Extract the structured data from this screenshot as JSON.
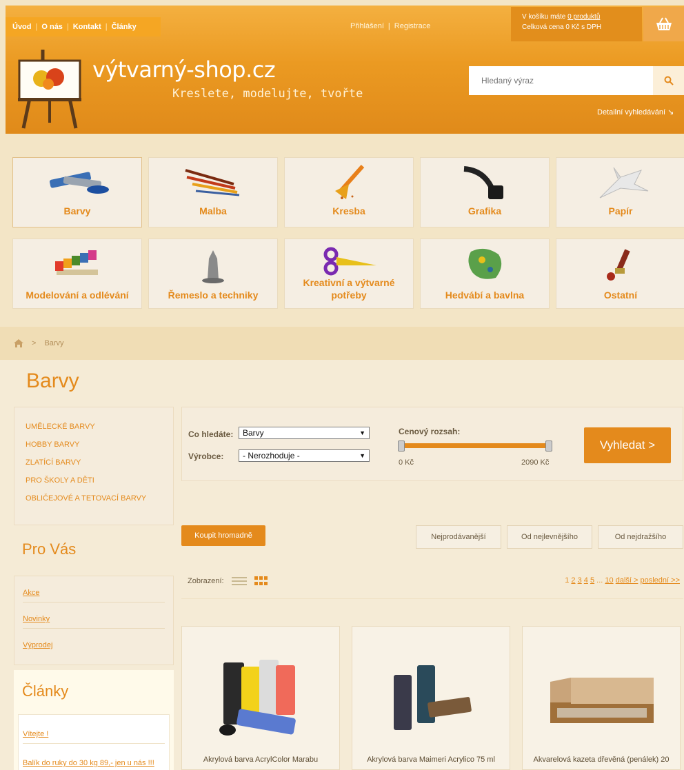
{
  "topnav": {
    "items": [
      "Úvod",
      "O nás",
      "Kontakt",
      "Články"
    ]
  },
  "auth": {
    "login": "Přihlášení",
    "register": "Registrace"
  },
  "cart": {
    "line1_prefix": "V košíku máte ",
    "line1_link": "0 produktů",
    "line2": "Celková cena 0 Kč s DPH"
  },
  "brand": {
    "name": "výtvarný-shop.cz",
    "slogan": "Kreslete, modelujte, tvořte"
  },
  "search": {
    "placeholder": "Hledaný výraz",
    "advanced": "Detailní vyhledávání"
  },
  "categories": [
    {
      "label": "Barvy",
      "icon": "paint-tubes-icon"
    },
    {
      "label": "Malba",
      "icon": "brushes-icon"
    },
    {
      "label": "Kresba",
      "icon": "pencil-icon"
    },
    {
      "label": "Grafika",
      "icon": "ink-quill-icon"
    },
    {
      "label": "Papír",
      "icon": "origami-icon"
    },
    {
      "label": "Modelování a odlévání",
      "icon": "clay-icon"
    },
    {
      "label": "Řemeslo a techniky",
      "icon": "sculpture-icon"
    },
    {
      "label": "Kreativní a výtvarné potřeby",
      "icon": "scissors-icon"
    },
    {
      "label": "Hedvábí a bavlna",
      "icon": "silk-icon"
    },
    {
      "label": "Ostatní",
      "icon": "wax-seal-icon"
    }
  ],
  "breadcrumb": {
    "current": "Barvy"
  },
  "page": {
    "title": "Barvy"
  },
  "subcategories": [
    "UMĚLECKÉ BARVY",
    "HOBBY BARVY",
    "ZLATÍCÍ BARVY",
    "PRO ŠKOLY A DĚTI",
    "OBLIČEJOVÉ A TETOVACÍ BARVY"
  ],
  "pro_vas": {
    "title": "Pro Vás",
    "items": [
      "Akce",
      "Novinky",
      "Výprodej"
    ]
  },
  "clanky": {
    "title": "Články",
    "items": [
      "Vítejte !",
      "Balík do ruky do 30 kg 89,- jen u nás !!!"
    ]
  },
  "filter": {
    "what_label": "Co hledáte:",
    "what_value": "Barvy",
    "maker_label": "Výrobce:",
    "maker_value": "- Nerozhoduje -",
    "range_label": "Cenový rozsah:",
    "min": "0 Kč",
    "max": "2090 Kč",
    "submit": "Vyhledat >"
  },
  "sort": {
    "bulk": "Koupit hromadně",
    "options": [
      "Nejprodávanější",
      "Od nejlevnějšího",
      "Od nejdražšího"
    ]
  },
  "view": {
    "label": "Zobrazení:"
  },
  "pager": {
    "pages": [
      "1",
      "2",
      "3",
      "4",
      "5"
    ],
    "ellipsis": "...",
    "last_num": "10",
    "next": "další >",
    "last": "poslední >>"
  },
  "products": [
    {
      "name": "Akrylová barva AcrylColor Marabu"
    },
    {
      "name": "Akrylová barva Maimeri Acrylico 75 ml"
    },
    {
      "name": "Akvarelová kazeta dřevěná (penálek) 20"
    }
  ],
  "colors": {
    "accent": "#e48a1c",
    "header": "#eb9a22",
    "bg": "#f3e5c6"
  }
}
